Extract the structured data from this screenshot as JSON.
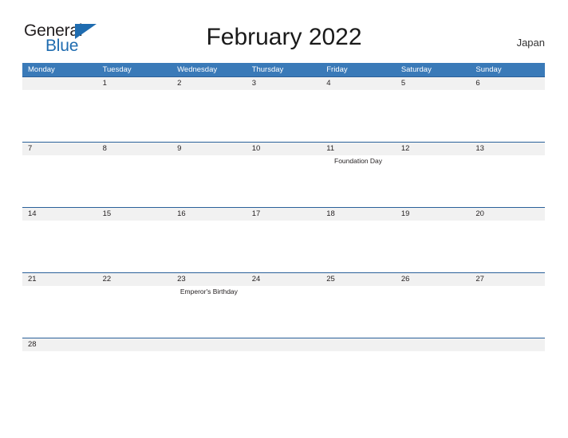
{
  "brand": {
    "line1": "General",
    "line2": "Blue",
    "triangle_icon": "triangle-icon",
    "color_dark": "#231f20",
    "color_blue": "#1f6cb0"
  },
  "header": {
    "title": "February 2022",
    "country": "Japan"
  },
  "theme": {
    "header_blue": "#3a7ab8",
    "row_line_blue": "#2a6099",
    "row_band_gray": "#f1f1f1",
    "text_dark": "#231f20",
    "page_background": "#ffffff"
  },
  "calendar": {
    "weekdays": [
      "Monday",
      "Tuesday",
      "Wednesday",
      "Thursday",
      "Friday",
      "Saturday",
      "Sunday"
    ],
    "weeks": [
      {
        "short": false,
        "days": [
          {
            "num": "",
            "event": ""
          },
          {
            "num": "1",
            "event": ""
          },
          {
            "num": "2",
            "event": ""
          },
          {
            "num": "3",
            "event": ""
          },
          {
            "num": "4",
            "event": ""
          },
          {
            "num": "5",
            "event": ""
          },
          {
            "num": "6",
            "event": ""
          }
        ]
      },
      {
        "short": false,
        "days": [
          {
            "num": "7",
            "event": ""
          },
          {
            "num": "8",
            "event": ""
          },
          {
            "num": "9",
            "event": ""
          },
          {
            "num": "10",
            "event": ""
          },
          {
            "num": "11",
            "event": "Foundation Day"
          },
          {
            "num": "12",
            "event": ""
          },
          {
            "num": "13",
            "event": ""
          }
        ]
      },
      {
        "short": false,
        "days": [
          {
            "num": "14",
            "event": ""
          },
          {
            "num": "15",
            "event": ""
          },
          {
            "num": "16",
            "event": ""
          },
          {
            "num": "17",
            "event": ""
          },
          {
            "num": "18",
            "event": ""
          },
          {
            "num": "19",
            "event": ""
          },
          {
            "num": "20",
            "event": ""
          }
        ]
      },
      {
        "short": false,
        "days": [
          {
            "num": "21",
            "event": ""
          },
          {
            "num": "22",
            "event": ""
          },
          {
            "num": "23",
            "event": "Emperor's Birthday"
          },
          {
            "num": "24",
            "event": ""
          },
          {
            "num": "25",
            "event": ""
          },
          {
            "num": "26",
            "event": ""
          },
          {
            "num": "27",
            "event": ""
          }
        ]
      },
      {
        "short": true,
        "days": [
          {
            "num": "28",
            "event": ""
          },
          {
            "num": "",
            "event": ""
          },
          {
            "num": "",
            "event": ""
          },
          {
            "num": "",
            "event": ""
          },
          {
            "num": "",
            "event": ""
          },
          {
            "num": "",
            "event": ""
          },
          {
            "num": "",
            "event": ""
          }
        ]
      }
    ]
  }
}
